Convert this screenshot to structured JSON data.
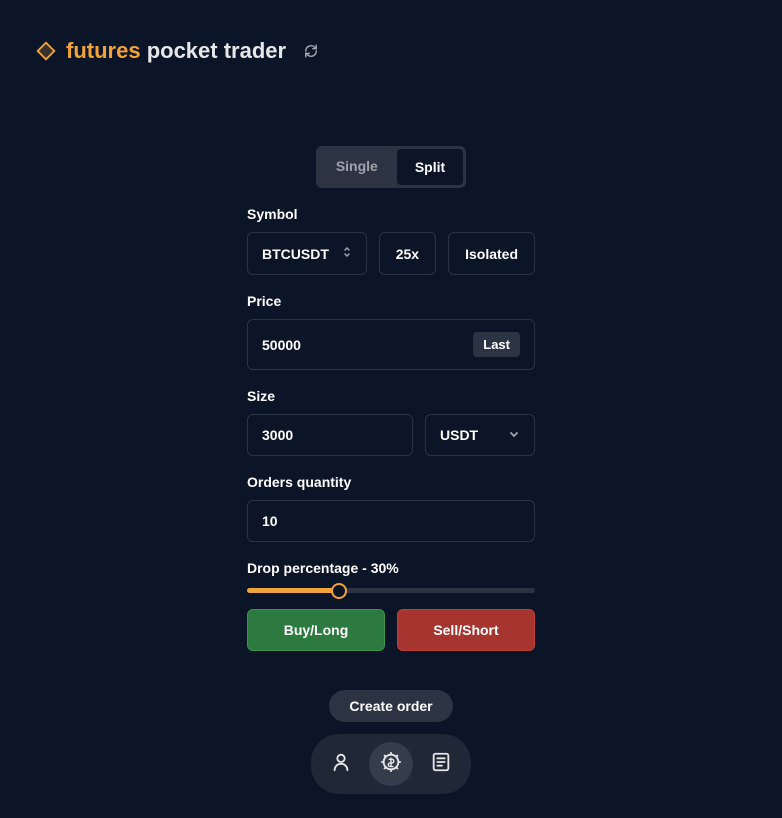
{
  "header": {
    "brand_accent": "futures ",
    "brand_rest": "pocket trader"
  },
  "tabs": {
    "single": "Single",
    "split": "Split"
  },
  "form": {
    "symbol_label": "Symbol",
    "symbol_value": "BTCUSDT",
    "leverage": "25x",
    "margin_type": "Isolated",
    "price_label": "Price",
    "price_value": "50000",
    "price_quick": "Last",
    "size_label": "Size",
    "size_value": "3000",
    "size_unit": "USDT",
    "qty_label": "Orders quantity",
    "qty_value": "10",
    "drop_label": "Drop percentage - 30%",
    "drop_percent": 30,
    "buy_label": "Buy/Long",
    "sell_label": "Sell/Short"
  },
  "nav": {
    "tooltip": "Create order"
  }
}
